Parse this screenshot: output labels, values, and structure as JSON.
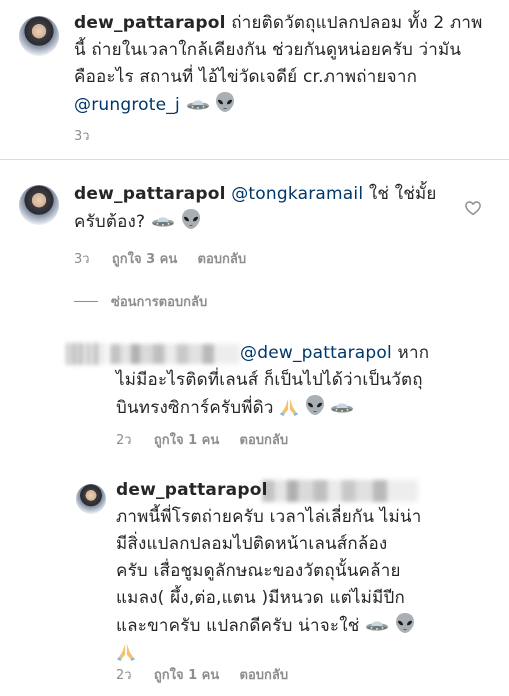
{
  "comments": [
    {
      "username": "dew_pattarapol",
      "lines": [
        "ถ่ายติดวัตถุแปลกปลอม ทั้ง 2 ภาพ",
        "นี้ ถ่ายในเวลาใกล้เคียงกัน ช่วยกันดูหน่อยครับ ว่ามัน",
        "คืออะไร สถานที่ ไอ้ไข่วัดเจดีย์ cr.ภาพถ่ายจาก"
      ],
      "mention": "@rungrote_j",
      "time": "3ว"
    },
    {
      "username": "dew_pattarapol",
      "mention": "@tongkaramail",
      "text_after_mention": "ใช่ ใช่มั้ย",
      "line2": "ครับต้อง?",
      "time": "3ว",
      "likes": "ถูกใจ 3 คน",
      "reply": "ตอบกลับ"
    }
  ],
  "hide_replies": "ซ่อนการตอบกลับ",
  "replies": [
    {
      "mention": "@dew_pattarapol",
      "text_after_mention": "หาก",
      "lines": [
        "ไม่มีอะไรติดที่เลนส์ ก็เป็นไปได้ว่าเป็นวัตถุ",
        "บินทรงซิการ์ครับพี่ดิว"
      ],
      "time": "2ว",
      "likes": "ถูกใจ 1 คน",
      "reply": "ตอบกลับ"
    },
    {
      "username": "dew_pattarapol",
      "lines": [
        "ภาพนี้พี่โรตถ่ายครับ เวลาไล่เลี่ยกัน ไม่น่า",
        "มีสิ่งแปลกปลอมไปติดหน้าเลนส์กล้อง",
        "ครับ เสื่อชูมดูลักษณะของวัตถุนั้นคล้าย",
        "แมลง( ผึ้ง,ต่อ,แตน )มีหนวด แต่ไม่มีปีก",
        "และขาครับ แปลกดีครับ น่าจะใช่"
      ],
      "time": "2ว",
      "likes": "ถูกใจ 1 คน",
      "reply": "ตอบกลับ"
    }
  ],
  "icons": {
    "ufo": "ufo-emoji-icon",
    "alien": "alien-emoji-icon",
    "pray": "folded-hands-emoji-icon",
    "heart": "heart-outline-icon"
  }
}
